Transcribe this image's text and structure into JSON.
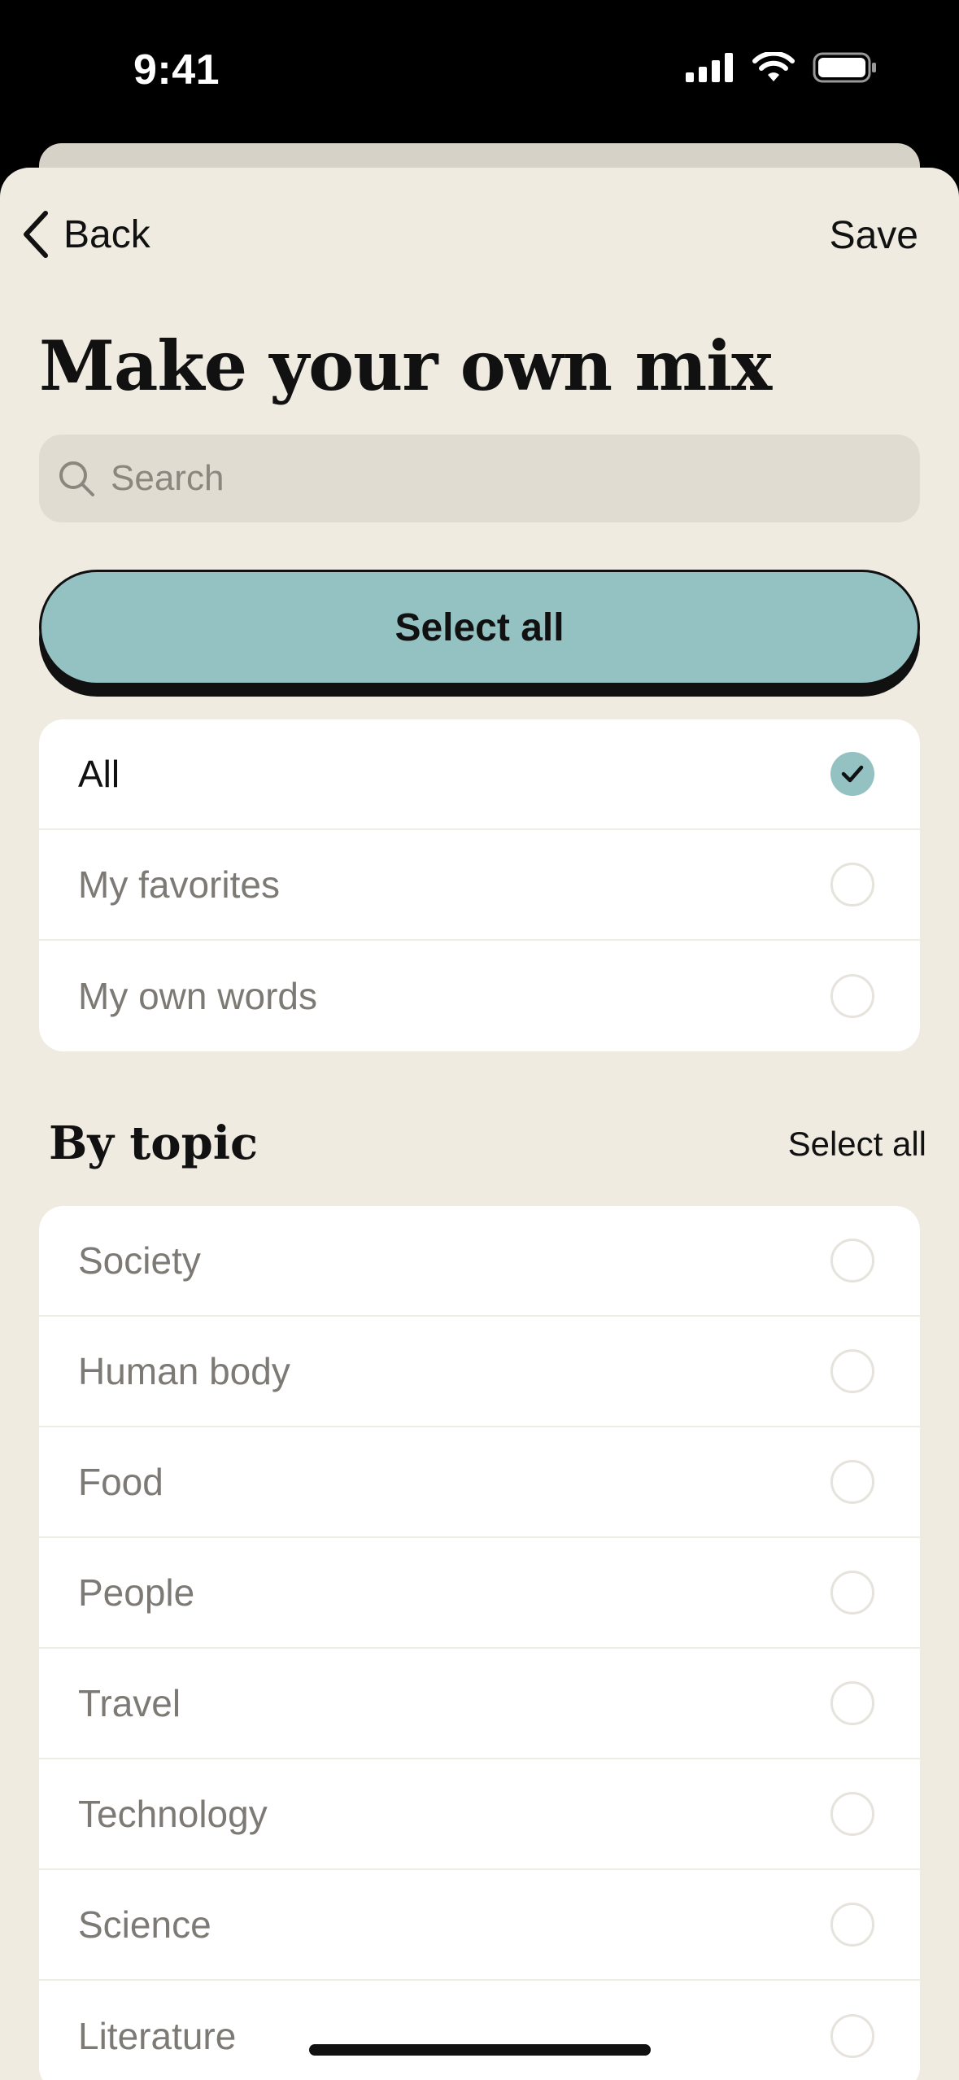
{
  "status": {
    "time": "9:41"
  },
  "nav": {
    "back_label": "Back",
    "save_label": "Save"
  },
  "title": "Make your own mix",
  "search": {
    "placeholder": "Search",
    "value": ""
  },
  "select_all_button": "Select all",
  "main_options": [
    {
      "label": "All",
      "selected": true
    },
    {
      "label": "My favorites",
      "selected": false
    },
    {
      "label": "My own words",
      "selected": false
    }
  ],
  "topics": {
    "heading": "By topic",
    "select_all_label": "Select all",
    "items": [
      {
        "label": "Society",
        "selected": false
      },
      {
        "label": "Human body",
        "selected": false
      },
      {
        "label": "Food",
        "selected": false
      },
      {
        "label": "People",
        "selected": false
      },
      {
        "label": "Travel",
        "selected": false
      },
      {
        "label": "Technology",
        "selected": false
      },
      {
        "label": "Science",
        "selected": false
      },
      {
        "label": "Literature",
        "selected": false
      }
    ]
  },
  "colors": {
    "background": "#efebe1",
    "accent": "#94c1c1",
    "card": "#ffffff",
    "text": "#111111",
    "muted_text": "#7d7a75"
  },
  "icons": {
    "back": "chevron-left-icon",
    "search": "magnifier-icon",
    "check": "checkmark-icon"
  }
}
